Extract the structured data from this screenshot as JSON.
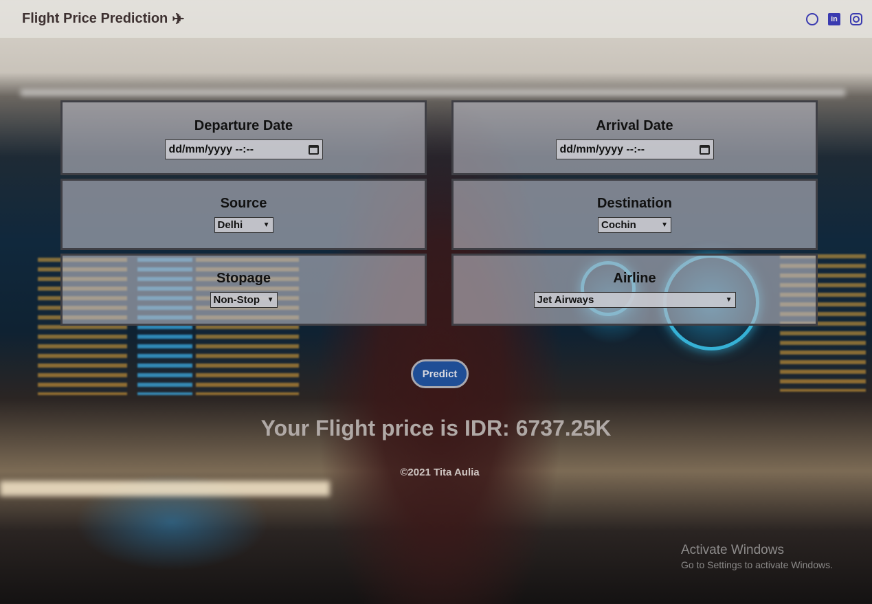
{
  "navbar": {
    "brand": "Flight Price Prediction",
    "brand_icon": "airplane-icon",
    "social_icons": [
      "github-icon",
      "linkedin-icon",
      "instagram-icon"
    ],
    "social_color": "#3a3ab0"
  },
  "form": {
    "departure": {
      "label": "Departure Date",
      "value": "dd/mm/yyyy --:--"
    },
    "arrival": {
      "label": "Arrival Date",
      "value": "dd/mm/yyyy --:--"
    },
    "source": {
      "label": "Source",
      "selected": "Delhi"
    },
    "destination": {
      "label": "Destination",
      "selected": "Cochin"
    },
    "stopage": {
      "label": "Stopage",
      "selected": "Non-Stop"
    },
    "airline": {
      "label": "Airline",
      "selected": "Jet Airways"
    }
  },
  "predict_button": {
    "label": "Predict",
    "color": "#1f4e96"
  },
  "result": "Your Flight price is IDR: 6737.25K",
  "footer": "©2021 Tita Aulia",
  "watermark": {
    "title": "Activate Windows",
    "subtitle": "Go to Settings to activate Windows."
  }
}
